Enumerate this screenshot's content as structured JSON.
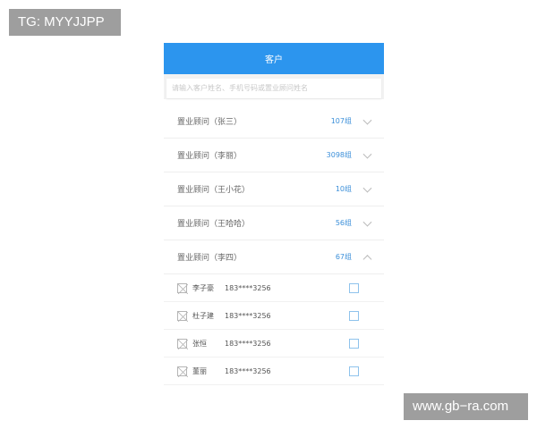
{
  "watermarks": {
    "top_left": "TG: MYYJJPP",
    "bottom_right": "www.gb−ra.com"
  },
  "header": {
    "title": "客户"
  },
  "search": {
    "placeholder": "请输入客户姓名、手机号码或置业顾问姓名"
  },
  "groups": [
    {
      "name": "置业顾问（张三）",
      "count": "107组",
      "expanded": false
    },
    {
      "name": "置业顾问（李丽）",
      "count": "3098组",
      "expanded": false
    },
    {
      "name": "置业顾问（王小花）",
      "count": "10组",
      "expanded": false
    },
    {
      "name": "置业顾问（王哈哈）",
      "count": "56组",
      "expanded": false
    },
    {
      "name": "置业顾问（李四）",
      "count": "67组",
      "expanded": true
    }
  ],
  "members": [
    {
      "name": "李子豪",
      "phone": "183****3256",
      "checked": false
    },
    {
      "name": "杜子建",
      "phone": "183****3256",
      "checked": false
    },
    {
      "name": "张恒",
      "phone": "183****3256",
      "checked": false
    },
    {
      "name": "董丽",
      "phone": "183****3256",
      "checked": false
    }
  ],
  "colors": {
    "header_bg": "#2c95ee",
    "count_text": "#3b8fd9",
    "checkbox_border": "#8fc3ec",
    "watermark_bg": "#9e9e9e"
  },
  "icons": {
    "avatar": "image-placeholder-icon",
    "collapsed": "chevron-down-icon",
    "expanded": "chevron-up-icon"
  }
}
